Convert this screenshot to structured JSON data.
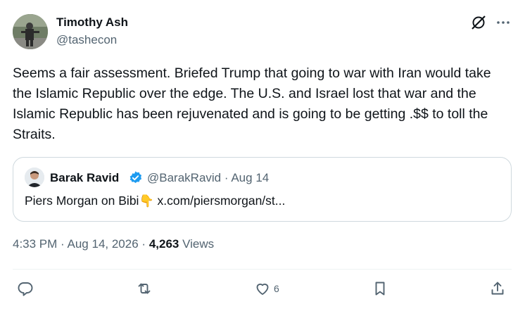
{
  "author": {
    "name": "Timothy Ash",
    "handle": "@tashecon"
  },
  "tweet": {
    "text": "Seems a fair assessment. Briefed Trump that going to war with Iran would take the Islamic Republic over the edge. The U.S. and Israel lost that war and the Islamic Republic has been rejuvenated and is going to be getting .$$ to toll the Straits."
  },
  "quote": {
    "name": "Barak Ravid",
    "handle": "@BarakRavid",
    "separator": "·",
    "date": "Aug 14",
    "text": "Piers Morgan on Bibi",
    "emoji": "👇",
    "link": "x.com/piersmorgan/st..."
  },
  "meta": {
    "time": "4:33 PM",
    "separator1": "·",
    "date": "Aug 14, 2026",
    "separator2": "·",
    "views_count": "4,263",
    "views_label": "Views"
  },
  "actions": {
    "like_count": "6"
  },
  "icons": {
    "grok": "grok-slash-icon",
    "more": "more-horizontal-icon",
    "verified": "verified-badge-icon",
    "reply": "reply-icon",
    "retweet": "retweet-icon",
    "like": "heart-icon",
    "bookmark": "bookmark-icon",
    "share": "share-icon"
  },
  "colors": {
    "text_primary": "#0f1419",
    "text_secondary": "#536471",
    "verified_blue": "#1d9bf0",
    "border": "#cfd9de"
  }
}
